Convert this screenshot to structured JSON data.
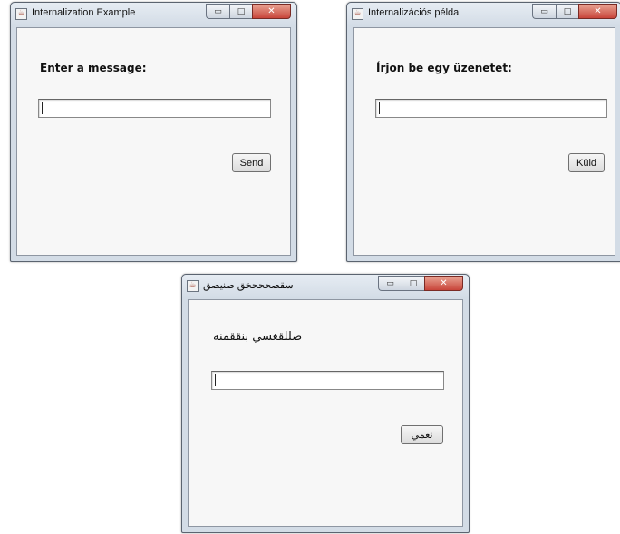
{
  "windows": [
    {
      "title": "Internalization Example",
      "prompt": "Enter a message:",
      "button_label": "Send",
      "input_value": ""
    },
    {
      "title": "Internalizációs példa",
      "prompt": "Írjon be egy üzenetet:",
      "button_label": "Küld",
      "input_value": ""
    },
    {
      "title": "سقصحححخق صنيصق",
      "prompt": "صللقغسي بنققمنه",
      "button_label": "نعمي",
      "input_value": ""
    }
  ],
  "window_controls": {
    "minimize_glyph": "▭",
    "maximize_glyph": "□",
    "close_glyph": "✕"
  },
  "icons": {
    "app_icon": "java-app-icon",
    "app_icon_glyph": "☕"
  }
}
